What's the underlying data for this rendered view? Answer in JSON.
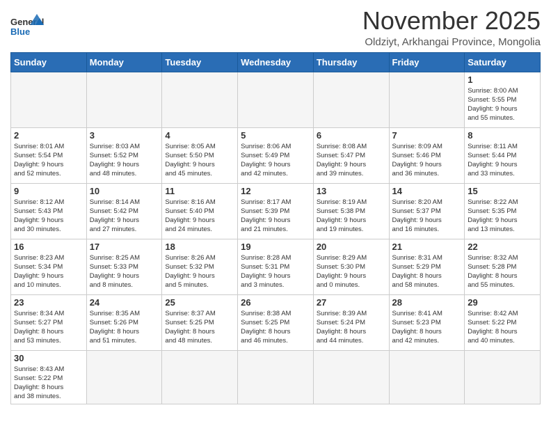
{
  "logo": {
    "text_general": "General",
    "text_blue": "Blue"
  },
  "title": "November 2025",
  "location": "Oldziyt, Arkhangai Province, Mongolia",
  "weekdays": [
    "Sunday",
    "Monday",
    "Tuesday",
    "Wednesday",
    "Thursday",
    "Friday",
    "Saturday"
  ],
  "days": [
    {
      "num": null,
      "info": ""
    },
    {
      "num": null,
      "info": ""
    },
    {
      "num": null,
      "info": ""
    },
    {
      "num": null,
      "info": ""
    },
    {
      "num": null,
      "info": ""
    },
    {
      "num": null,
      "info": ""
    },
    {
      "num": "1",
      "info": "Sunrise: 8:00 AM\nSunset: 5:55 PM\nDaylight: 9 hours\nand 55 minutes."
    },
    {
      "num": "2",
      "info": "Sunrise: 8:01 AM\nSunset: 5:54 PM\nDaylight: 9 hours\nand 52 minutes."
    },
    {
      "num": "3",
      "info": "Sunrise: 8:03 AM\nSunset: 5:52 PM\nDaylight: 9 hours\nand 48 minutes."
    },
    {
      "num": "4",
      "info": "Sunrise: 8:05 AM\nSunset: 5:50 PM\nDaylight: 9 hours\nand 45 minutes."
    },
    {
      "num": "5",
      "info": "Sunrise: 8:06 AM\nSunset: 5:49 PM\nDaylight: 9 hours\nand 42 minutes."
    },
    {
      "num": "6",
      "info": "Sunrise: 8:08 AM\nSunset: 5:47 PM\nDaylight: 9 hours\nand 39 minutes."
    },
    {
      "num": "7",
      "info": "Sunrise: 8:09 AM\nSunset: 5:46 PM\nDaylight: 9 hours\nand 36 minutes."
    },
    {
      "num": "8",
      "info": "Sunrise: 8:11 AM\nSunset: 5:44 PM\nDaylight: 9 hours\nand 33 minutes."
    },
    {
      "num": "9",
      "info": "Sunrise: 8:12 AM\nSunset: 5:43 PM\nDaylight: 9 hours\nand 30 minutes."
    },
    {
      "num": "10",
      "info": "Sunrise: 8:14 AM\nSunset: 5:42 PM\nDaylight: 9 hours\nand 27 minutes."
    },
    {
      "num": "11",
      "info": "Sunrise: 8:16 AM\nSunset: 5:40 PM\nDaylight: 9 hours\nand 24 minutes."
    },
    {
      "num": "12",
      "info": "Sunrise: 8:17 AM\nSunset: 5:39 PM\nDaylight: 9 hours\nand 21 minutes."
    },
    {
      "num": "13",
      "info": "Sunrise: 8:19 AM\nSunset: 5:38 PM\nDaylight: 9 hours\nand 19 minutes."
    },
    {
      "num": "14",
      "info": "Sunrise: 8:20 AM\nSunset: 5:37 PM\nDaylight: 9 hours\nand 16 minutes."
    },
    {
      "num": "15",
      "info": "Sunrise: 8:22 AM\nSunset: 5:35 PM\nDaylight: 9 hours\nand 13 minutes."
    },
    {
      "num": "16",
      "info": "Sunrise: 8:23 AM\nSunset: 5:34 PM\nDaylight: 9 hours\nand 10 minutes."
    },
    {
      "num": "17",
      "info": "Sunrise: 8:25 AM\nSunset: 5:33 PM\nDaylight: 9 hours\nand 8 minutes."
    },
    {
      "num": "18",
      "info": "Sunrise: 8:26 AM\nSunset: 5:32 PM\nDaylight: 9 hours\nand 5 minutes."
    },
    {
      "num": "19",
      "info": "Sunrise: 8:28 AM\nSunset: 5:31 PM\nDaylight: 9 hours\nand 3 minutes."
    },
    {
      "num": "20",
      "info": "Sunrise: 8:29 AM\nSunset: 5:30 PM\nDaylight: 9 hours\nand 0 minutes."
    },
    {
      "num": "21",
      "info": "Sunrise: 8:31 AM\nSunset: 5:29 PM\nDaylight: 8 hours\nand 58 minutes."
    },
    {
      "num": "22",
      "info": "Sunrise: 8:32 AM\nSunset: 5:28 PM\nDaylight: 8 hours\nand 55 minutes."
    },
    {
      "num": "23",
      "info": "Sunrise: 8:34 AM\nSunset: 5:27 PM\nDaylight: 8 hours\nand 53 minutes."
    },
    {
      "num": "24",
      "info": "Sunrise: 8:35 AM\nSunset: 5:26 PM\nDaylight: 8 hours\nand 51 minutes."
    },
    {
      "num": "25",
      "info": "Sunrise: 8:37 AM\nSunset: 5:25 PM\nDaylight: 8 hours\nand 48 minutes."
    },
    {
      "num": "26",
      "info": "Sunrise: 8:38 AM\nSunset: 5:25 PM\nDaylight: 8 hours\nand 46 minutes."
    },
    {
      "num": "27",
      "info": "Sunrise: 8:39 AM\nSunset: 5:24 PM\nDaylight: 8 hours\nand 44 minutes."
    },
    {
      "num": "28",
      "info": "Sunrise: 8:41 AM\nSunset: 5:23 PM\nDaylight: 8 hours\nand 42 minutes."
    },
    {
      "num": "29",
      "info": "Sunrise: 8:42 AM\nSunset: 5:22 PM\nDaylight: 8 hours\nand 40 minutes."
    },
    {
      "num": "30",
      "info": "Sunrise: 8:43 AM\nSunset: 5:22 PM\nDaylight: 8 hours\nand 38 minutes."
    }
  ]
}
